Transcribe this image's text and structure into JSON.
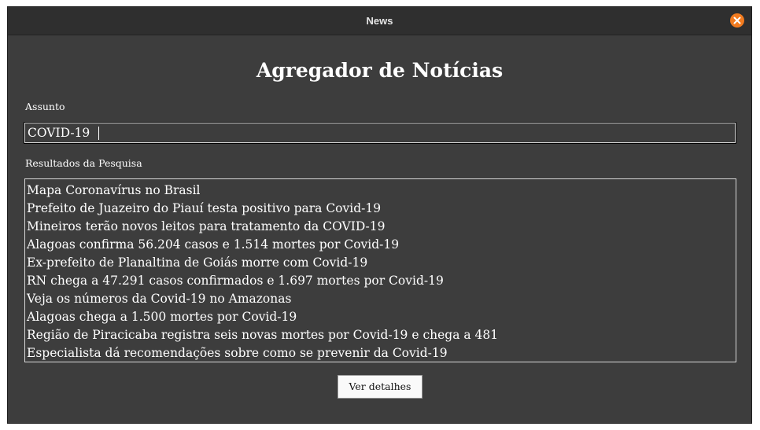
{
  "window": {
    "title": "News",
    "close_icon": "close-icon",
    "accent_color": "#f27b1f"
  },
  "main": {
    "heading": "Agregador de Notícias",
    "subject": {
      "label": "Assunto",
      "value": "COVID-19"
    },
    "results": {
      "label": "Resultados da Pesquisa",
      "items": [
        "Mapa Coronavírus no Brasil",
        "Prefeito de Juazeiro do Piauí testa positivo para Covid-19",
        "Mineiros terão novos leitos para tratamento da COVID-19",
        "Alagoas confirma 56.204 casos e 1.514 mortes por Covid-19",
        "Ex-prefeito de Planaltina de Goiás morre com Covid-19",
        "RN chega a 47.291 casos confirmados e 1.697 mortes por Covid-19",
        "Veja os números da Covid-19 no Amazonas",
        "Alagoas chega a 1.500 mortes por Covid-19",
        "Região de Piracicaba registra seis novas mortes por Covid-19 e chega a 481",
        "Especialista dá recomendações sobre como se prevenir da Covid-19"
      ]
    },
    "details_button": "Ver detalhes"
  }
}
